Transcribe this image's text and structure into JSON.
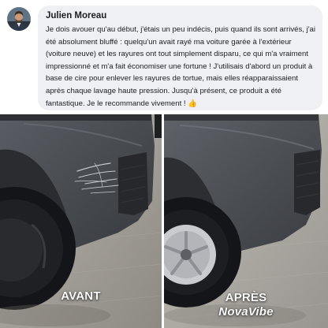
{
  "review": {
    "author": "Julien Moreau",
    "text": "Je dois avouer qu'au début, j'étais un peu indécis, puis quand ils sont arrivés, j'ai été absolument bluffé : quelqu'un avait rayé ma voiture garée à l'extérieur (voiture neuve) et les rayures ont tout simplement disparu, ce qui m'a vraiment impressionné et m'a fait économiser une fortune ! J'utilisais d'abord un produit à base de cire pour enlever les rayures de tortue, mais elles réapparaissaient après chaque lavage haute pression. Jusqu'à présent, ce produit a été fantastique. Je le recommande vivement !",
    "reaction_emoji": "👍"
  },
  "photos": {
    "before_label": "AVANT",
    "after_label": "APRÈS",
    "brand": "NovaVibe"
  },
  "colors": {
    "bubble": "#eef0f3",
    "text": "#1c1e21",
    "car_paint": "#4a4d52",
    "asphalt": "#a9a69f"
  },
  "icons": {
    "avatar": "user-avatar-photo",
    "reaction": "thumbs-up-emoji"
  }
}
